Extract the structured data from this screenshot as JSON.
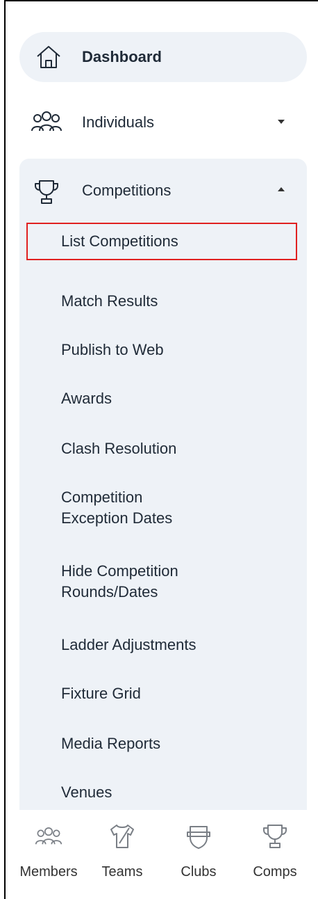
{
  "sidebar": {
    "dashboard": {
      "label": "Dashboard",
      "icon": "home-icon"
    },
    "individuals": {
      "label": "Individuals",
      "icon": "people-icon"
    },
    "competitions": {
      "label": "Competitions",
      "icon": "trophy-icon",
      "items": [
        {
          "label": "List Competitions"
        },
        {
          "label": "Match Results"
        },
        {
          "label": "Publish to Web"
        },
        {
          "label": "Awards"
        },
        {
          "label": "Clash Resolution"
        },
        {
          "label_lines": [
            "Competition",
            "Exception Dates"
          ]
        },
        {
          "label_lines": [
            "Hide Competition",
            "Rounds/Dates"
          ]
        },
        {
          "label": "Ladder Adjustments"
        },
        {
          "label": "Fixture Grid"
        },
        {
          "label": "Media Reports"
        },
        {
          "label": "Venues"
        }
      ]
    }
  },
  "bottom_nav": {
    "tabs": [
      {
        "label": "Members",
        "icon": "members-icon"
      },
      {
        "label": "Teams",
        "icon": "jersey-icon"
      },
      {
        "label": "Clubs",
        "icon": "club-shield-icon"
      },
      {
        "label": "Comps",
        "icon": "trophy-icon"
      }
    ]
  },
  "colors": {
    "panel_bg": "#eef2f7",
    "highlight_border": "#e02020",
    "text": "#1f2a37"
  }
}
